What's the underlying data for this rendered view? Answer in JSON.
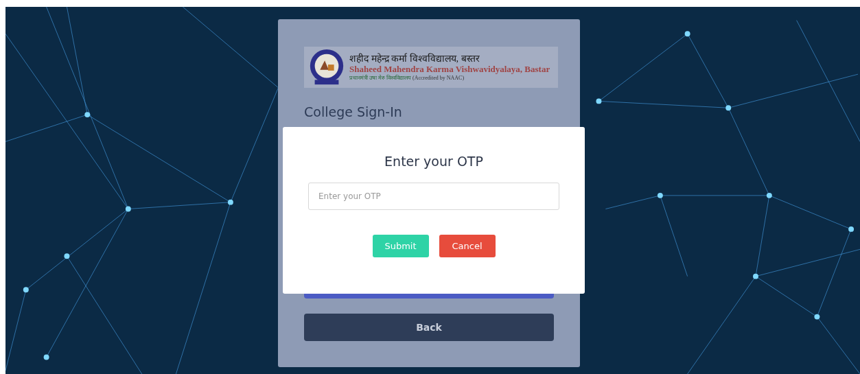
{
  "logo": {
    "hindi_name": "शहीद महेन्द्र कर्मा विश्वविद्यालय, बस्तर",
    "english_name": "Shaheed Mahendra Karma Vishwavidyalaya, Bastar",
    "tagline_hindi": "प्रधानमंत्री उषा मेरु विश्वविद्यालय",
    "tagline_english": "(Accredited by NAAC)"
  },
  "form": {
    "title": "College Sign-In",
    "back_button": "Back"
  },
  "modal": {
    "title": "Enter your OTP",
    "otp_field": {
      "placeholder": "Enter your OTP"
    },
    "buttons": [
      {
        "label": "Submit",
        "kind": "confirm"
      },
      {
        "label": "Cancel",
        "kind": "cancel"
      }
    ]
  }
}
